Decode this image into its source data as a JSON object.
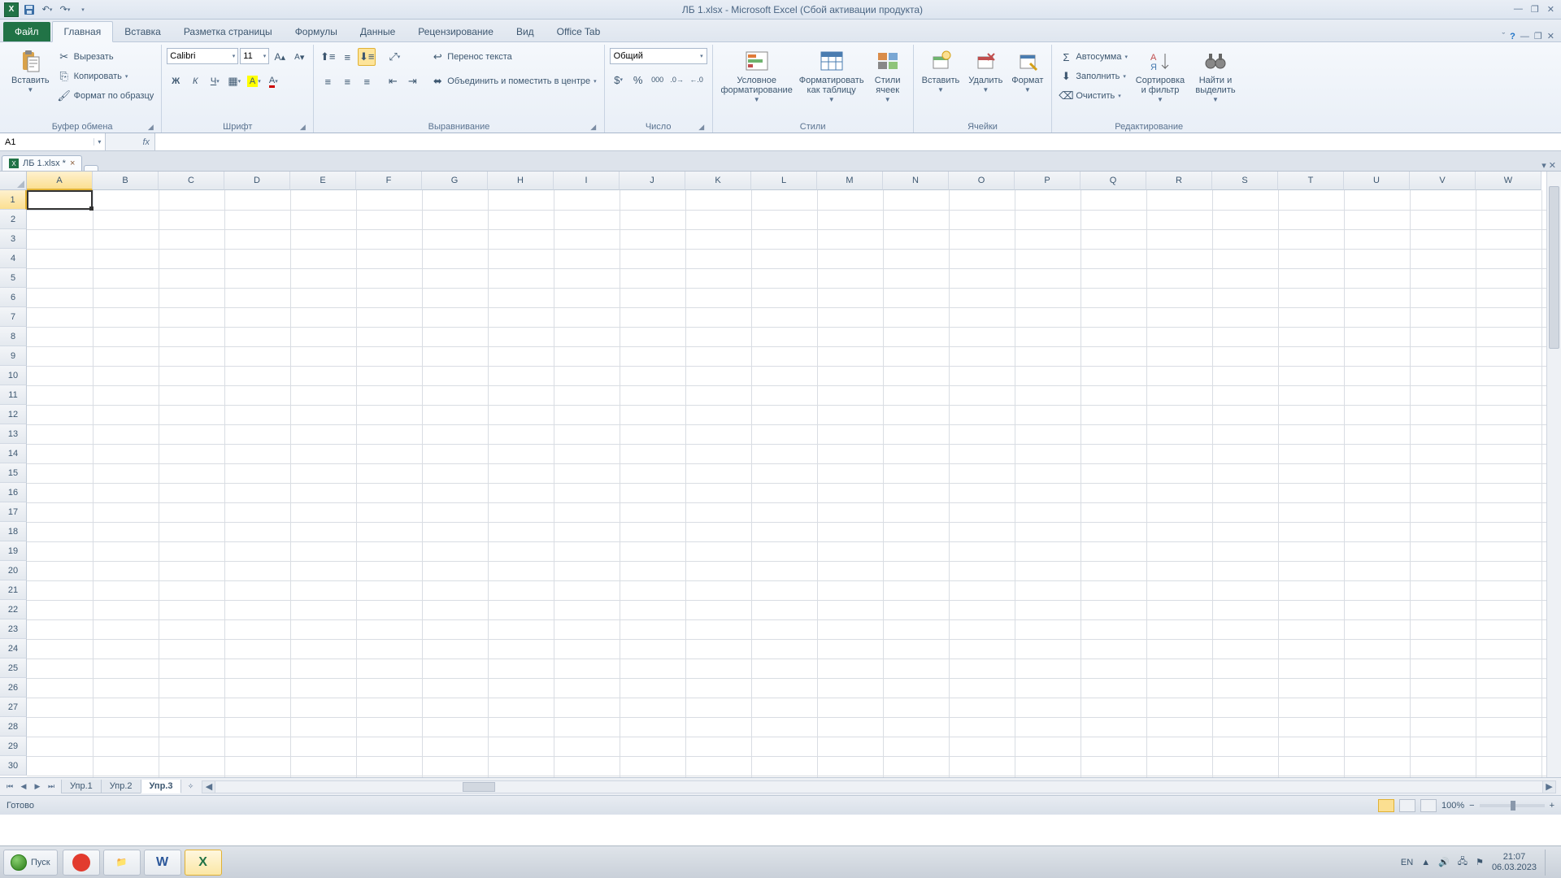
{
  "title": "ЛБ 1.xlsx - Microsoft Excel (Сбой активации продукта)",
  "qat": {
    "save": "💾",
    "undo": "↶",
    "redo": "↷"
  },
  "tabs": {
    "file": "Файл",
    "items": [
      "Главная",
      "Вставка",
      "Разметка страницы",
      "Формулы",
      "Данные",
      "Рецензирование",
      "Вид",
      "Office Tab"
    ],
    "active": 0
  },
  "ribbon": {
    "clipboard": {
      "label": "Буфер обмена",
      "paste": "Вставить",
      "cut": "Вырезать",
      "copy": "Копировать",
      "format_painter": "Формат по образцу"
    },
    "font": {
      "label": "Шрифт",
      "name": "Calibri",
      "size": "11"
    },
    "align": {
      "label": "Выравнивание",
      "wrap": "Перенос текста",
      "merge": "Объединить и поместить в центре"
    },
    "number": {
      "label": "Число",
      "format": "Общий"
    },
    "styles": {
      "label": "Стили",
      "cond": "Условное форматирование",
      "table": "Форматировать как таблицу",
      "cell": "Стили ячеек"
    },
    "cells": {
      "label": "Ячейки",
      "insert": "Вставить",
      "delete": "Удалить",
      "format": "Формат"
    },
    "editing": {
      "label": "Редактирование",
      "sum": "Автосумма",
      "fill": "Заполнить",
      "clear": "Очистить",
      "sort": "Сортировка и фильтр",
      "find": "Найти и выделить"
    }
  },
  "namebox": "A1",
  "doctab": {
    "name": "ЛБ 1.xlsx *"
  },
  "columns": [
    "A",
    "B",
    "C",
    "D",
    "E",
    "F",
    "G",
    "H",
    "I",
    "J",
    "K",
    "L",
    "M",
    "N",
    "O",
    "P",
    "Q",
    "R",
    "S",
    "T",
    "U",
    "V",
    "W"
  ],
  "rows_count": 30,
  "sheets": {
    "items": [
      "Упр.1",
      "Упр.2",
      "Упр.3"
    ],
    "active": 2
  },
  "status": "Готово",
  "zoom": "100%",
  "lang": "EN",
  "taskbar": {
    "start": "Пуск",
    "time": "21:07",
    "date": "06.03.2023"
  }
}
